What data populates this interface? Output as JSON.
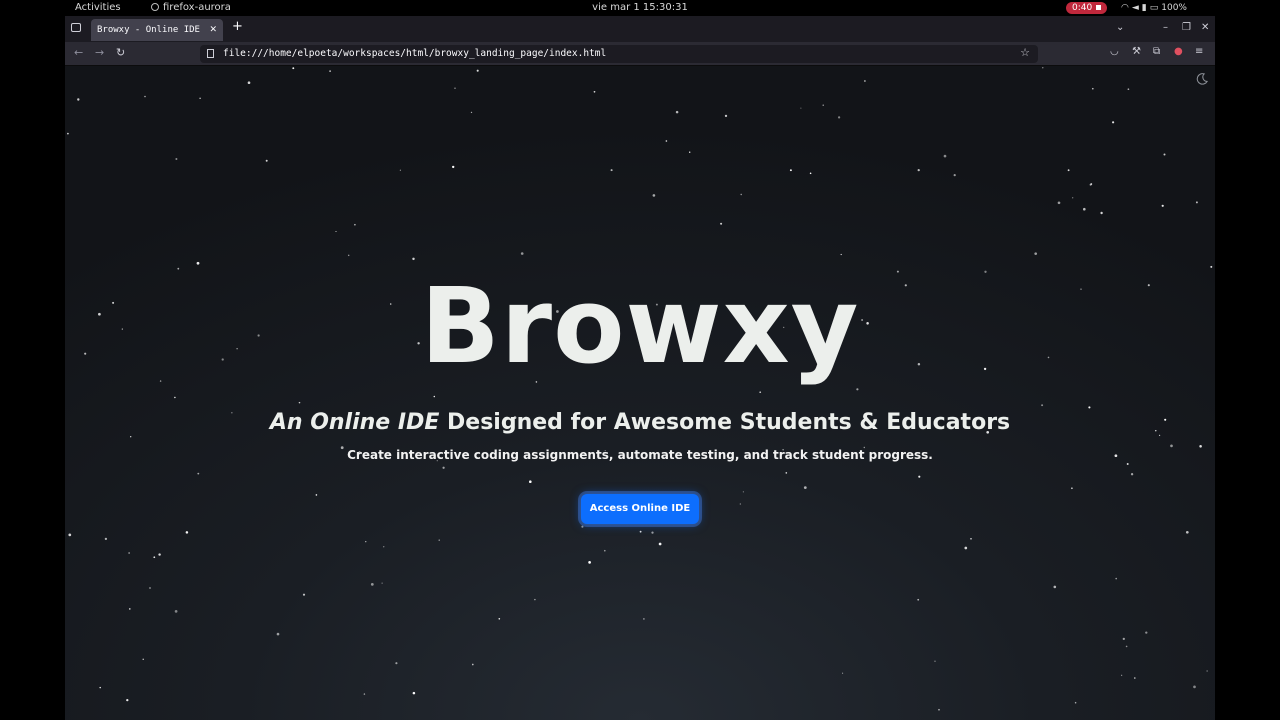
{
  "topbar": {
    "activities": "Activities",
    "app_name": "firefox-aurora",
    "clock": "vie mar 1 15:30:31",
    "recording": "0:40",
    "battery": "100%"
  },
  "browser": {
    "tab_title": "Browxy - Online IDE",
    "url": "file:///home/elpoeta/workspaces/html/browxy_landing_page/index.html"
  },
  "hero": {
    "title": "Browxy",
    "subtitle_italic": "An Online IDE",
    "subtitle_rest": "Designed for Awesome Students & Educators",
    "tagline": "Create interactive coding assignments, automate testing, and track student progress.",
    "cta_label": "Access Online IDE"
  },
  "colors": {
    "accent": "#0d6efd",
    "background": "#15181d",
    "recording": "#c0283c"
  },
  "icons": {
    "theme_toggle": "moon-icon"
  }
}
